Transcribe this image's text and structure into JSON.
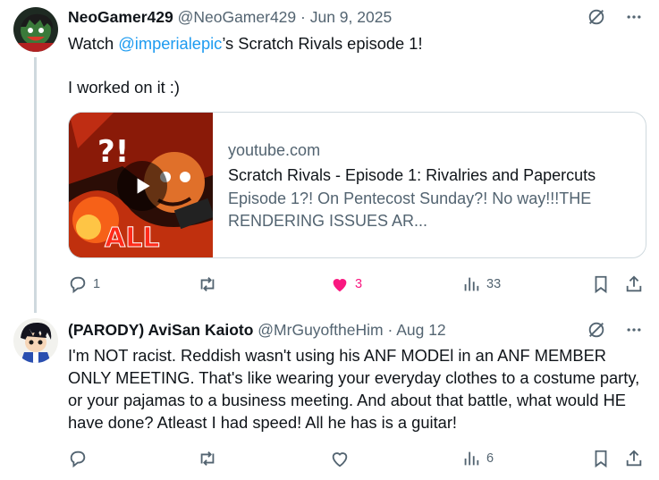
{
  "posts": [
    {
      "display_name": "NeoGamer429",
      "handle": "@NeoGamer429",
      "separator": "·",
      "date": "Jun 9, 2025",
      "text_prefix": "Watch ",
      "mention": "@imperialepic",
      "text_suffix": "’s Scratch Rivals episode 1!",
      "text_line2": "I worked on it :)",
      "card": {
        "domain": "youtube.com",
        "title": "Scratch Rivals - Episode 1: Rivalries and Papercuts",
        "description": "Episode 1?! On Pentecost Sunday?! No way!!!THE RENDERING ISSUES AR...",
        "thumb_text_top": "?!",
        "thumb_text_bottom": "ALL"
      },
      "actions": {
        "replies": "1",
        "reposts": "",
        "likes": "3",
        "views": "33"
      }
    },
    {
      "display_name": "(PARODY) AviSan Kaioto",
      "handle": "@MrGuyoftheHim",
      "separator": "·",
      "date": "Aug 12",
      "text": "I'm NOT racist. Reddish wasn't using his ANF MODEl in an ANF MEMBER ONLY MEETING. That's like wearing your everyday clothes to a costume party, or your pajamas to a business meeting. And about that battle, what would HE have done? Atleast I had speed! All he has is a guitar!",
      "actions": {
        "replies": "",
        "reposts": "",
        "likes": "",
        "views": "6"
      }
    }
  ],
  "colors": {
    "text_primary": "#0f1419",
    "text_secondary": "#536471",
    "link": "#1d9bf0",
    "like_active": "#f91880",
    "border": "#cfd9de"
  },
  "icons": [
    "grok-icon",
    "more-icon",
    "reply-icon",
    "repost-icon",
    "like-icon",
    "views-icon",
    "bookmark-icon",
    "share-icon",
    "play-icon"
  ]
}
